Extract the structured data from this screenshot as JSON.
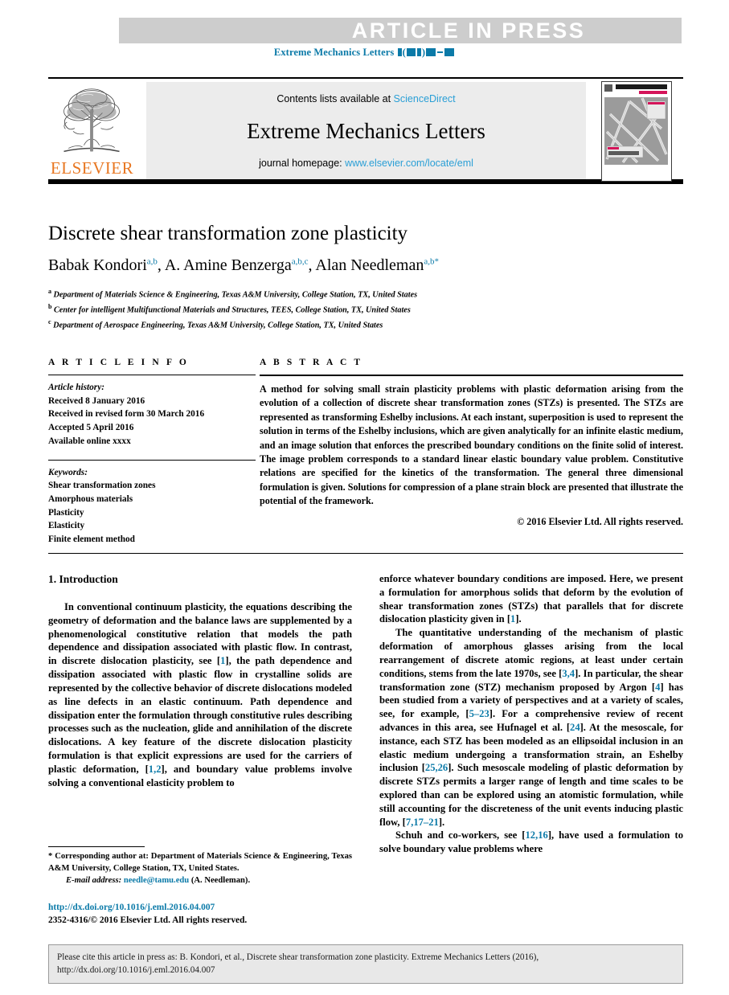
{
  "banner": {
    "text": "ARTICLE  IN  PRESS",
    "bg_color": "#cdcdcd",
    "text_color": "#ffffff"
  },
  "running_head": {
    "journal": "Extreme Mechanics Letters",
    "placeholder_note": "■ (■■) ■■–■■",
    "color": "#0b7aa8"
  },
  "masthead": {
    "contents_prefix": "Contents lists available at ",
    "contents_link": "ScienceDirect",
    "journal_title": "Extreme Mechanics Letters",
    "homepage_prefix": "journal homepage: ",
    "homepage_link": "www.elsevier.com/locate/eml",
    "publisher_logo_text": "ELSEVIER",
    "publisher_logo_color": "#e87722",
    "link_color": "#2a9fd6",
    "cover_title": "EXTREME MECHANICS",
    "cover_subtitle": "LETTERS"
  },
  "article": {
    "title": "Discrete shear transformation zone plasticity",
    "authors": [
      {
        "name": "Babak Kondori",
        "affil": "a,b",
        "sep": ", "
      },
      {
        "name": "A. Amine Benzerga",
        "affil": "a,b,c",
        "sep": ", "
      },
      {
        "name": "Alan Needleman",
        "affil": "a,b",
        "star": "*",
        "sep": ""
      }
    ],
    "affiliations": [
      {
        "marker": "a",
        "text": "Department of Materials Science & Engineering, Texas A&M University, College Station, TX, United States"
      },
      {
        "marker": "b",
        "text": "Center for intelligent Multifunctional Materials and Structures, TEES, College Station, TX, United States"
      },
      {
        "marker": "c",
        "text": "Department of Aerospace Engineering, Texas A&M University, College Station, TX, United States"
      }
    ]
  },
  "article_info": {
    "heading": "A R T I C L E   I N F O",
    "history_label": "Article history:",
    "history": [
      "Received 8 January 2016",
      "Received in revised form 30 March 2016",
      "Accepted 5 April 2016",
      "Available online xxxx"
    ],
    "keywords_label": "Keywords:",
    "keywords": [
      "Shear transformation zones",
      "Amorphous materials",
      "Plasticity",
      "Elasticity",
      "Finite element method"
    ]
  },
  "abstract": {
    "heading": "A B S T R A C T",
    "body": "A method for solving small strain plasticity problems with plastic deformation arising from the evolution of a collection of discrete shear transformation zones (STZs) is presented. The STZs are represented as transforming Eshelby inclusions. At each instant, superposition is used to represent the solution in terms of the Eshelby inclusions, which are given analytically for an infinite elastic medium, and an image solution that enforces the prescribed boundary conditions on the finite solid of interest. The image problem corresponds to a standard linear elastic boundary value problem. Constitutive relations are specified for the kinetics of the transformation. The general three dimensional formulation is given. Solutions for compression of a plane strain block are presented that illustrate the potential of the framework.",
    "copyright": "© 2016 Elsevier Ltd. All rights reserved."
  },
  "body": {
    "section_heading": "1. Introduction",
    "left_paragraphs": [
      "In conventional continuum plasticity, the equations describing the geometry of deformation and the balance laws are supplemented by a phenomenological constitutive relation that models the path dependence and dissipation associated with plastic flow. In contrast, in discrete dislocation plasticity, see [1], the path dependence and dissipation associated with plastic flow in crystalline solids are represented by the collective behavior of discrete dislocations modeled as line defects in an elastic continuum. Path dependence and dissipation enter the formulation through constitutive rules describing processes such as the nucleation, glide and annihilation of the discrete dislocations. A key feature of the discrete dislocation plasticity formulation is that explicit expressions are used for the carriers of plastic deformation, [1,2], and boundary value problems involve solving a conventional elasticity problem to"
    ],
    "right_paragraphs": [
      "enforce whatever boundary conditions are imposed. Here, we present a formulation for amorphous solids that deform by the evolution of shear transformation zones (STZs) that parallels that for discrete dislocation plasticity given in [1].",
      "The quantitative understanding of the mechanism of plastic deformation of amorphous glasses arising from the local rearrangement of discrete atomic regions, at least under certain conditions, stems from the late 1970s, see [3,4]. In particular, the shear transformation zone (STZ) mechanism proposed by Argon [4] has been studied from a variety of perspectives and at a variety of scales, see, for example, [5–23]. For a comprehensive review of recent advances in this area, see Hufnagel et al. [24]. At the mesoscale, for instance, each STZ has been modeled as an ellipsoidal inclusion in an elastic medium undergoing a transformation strain, an Eshelby inclusion [25,26]. Such mesoscale modeling of plastic deformation by discrete STZs permits a larger range of length and time scales to be explored than can be explored using an atomistic formulation, while still accounting for the discreteness of the unit events inducing plastic flow, [7,17–21].",
      "Schuh and co-workers, see [12,16], have used a formulation to solve boundary value problems where"
    ]
  },
  "footnote": {
    "star": "*",
    "corresponding": "Corresponding author at: Department of Materials Science & Engineering, Texas A&M University, College Station, TX, United States.",
    "email_label": "E-mail address:",
    "email": "needle@tamu.edu",
    "email_suffix": "(A. Needleman).",
    "doi_url": "http://dx.doi.org/10.1016/j.eml.2016.04.007",
    "issn_line": "2352-4316/© 2016 Elsevier Ltd. All rights reserved."
  },
  "cite_footer": {
    "line1": "Please cite this article in press as: B. Kondori, et al., Discrete shear transformation zone plasticity. Extreme Mechanics Letters (2016),",
    "line2": "http://dx.doi.org/10.1016/j.eml.2016.04.007"
  }
}
